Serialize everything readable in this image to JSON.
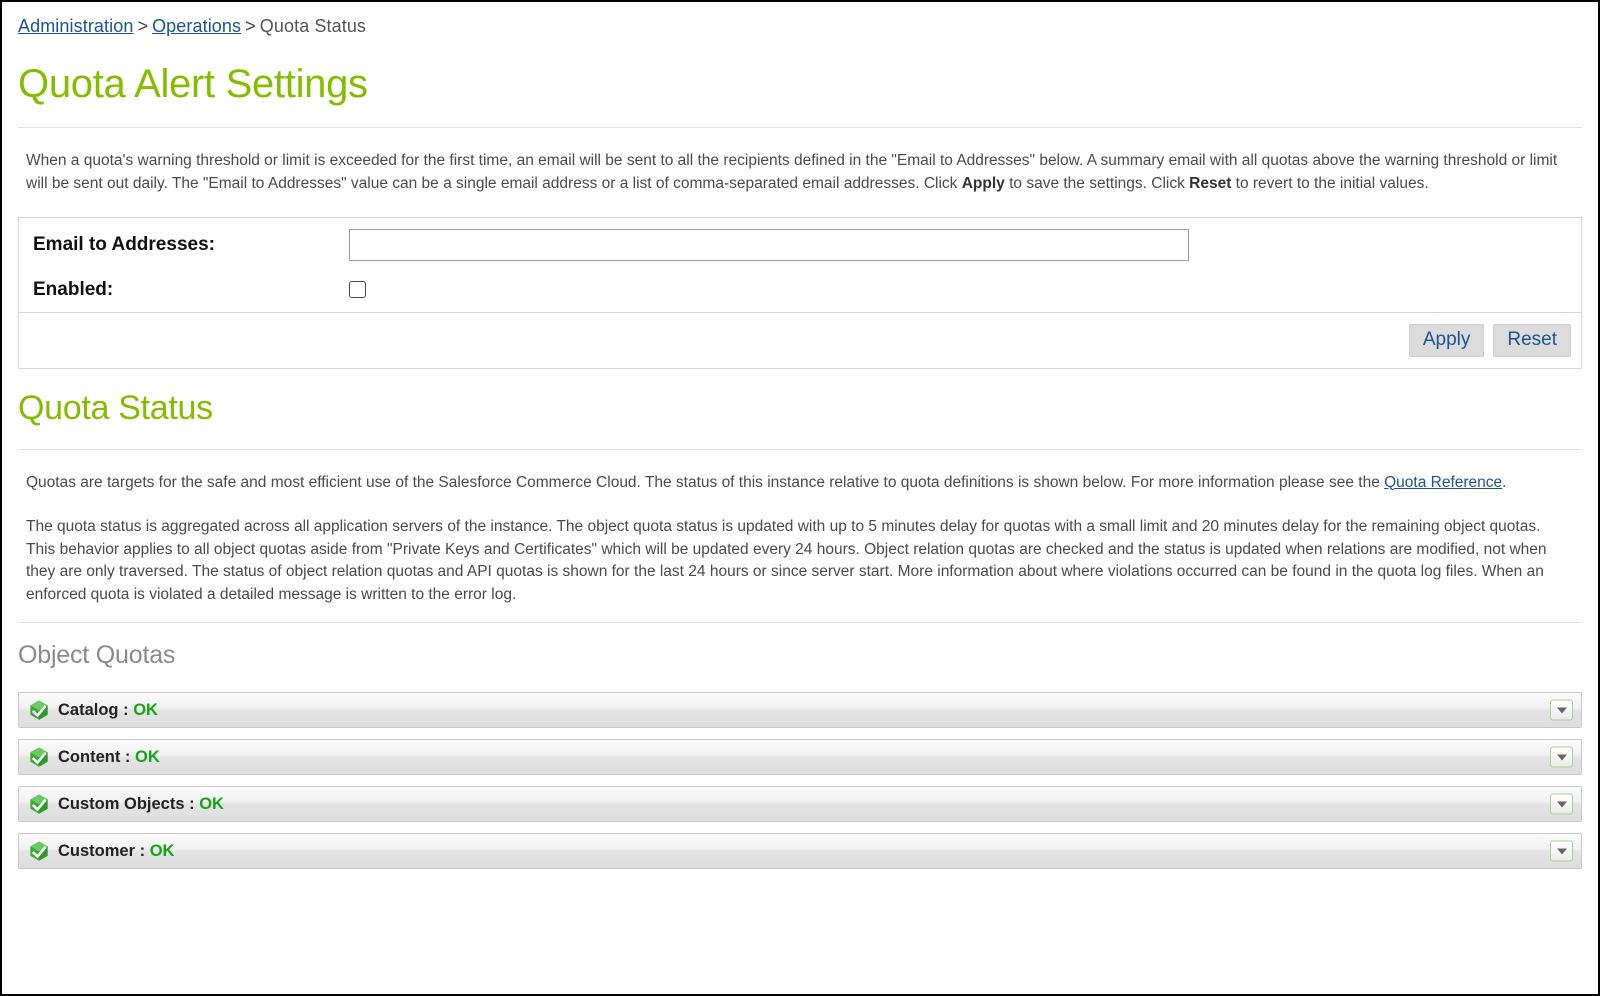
{
  "breadcrumb": {
    "items": [
      {
        "label": "Administration",
        "link": true
      },
      {
        "label": "Operations",
        "link": true
      },
      {
        "label": "Quota Status",
        "link": false
      }
    ],
    "separator": ">"
  },
  "alert_settings": {
    "title": "Quota Alert Settings",
    "description_parts": {
      "p1": "When a quota's warning threshold or limit is exceeded for the first time, an email will be sent to all the recipients defined in the \"Email to Addresses\" below. A summary email with all quotas above the warning threshold or limit will be sent out daily. The \"Email to Addresses\" value can be a single email address or a list of comma-separated email addresses. Click ",
      "apply_bold": "Apply",
      "p2": " to save the settings. Click ",
      "reset_bold": "Reset",
      "p3": " to revert to the initial values."
    },
    "email_label": "Email to Addresses:",
    "email_value": "",
    "email_placeholder": "",
    "enabled_label": "Enabled:",
    "enabled_checked": false,
    "apply_label": "Apply",
    "reset_label": "Reset"
  },
  "quota_status": {
    "title": "Quota Status",
    "intro_part1": "Quotas are targets for the safe and most efficient use of the Salesforce Commerce Cloud. The status of this instance relative to quota definitions is shown below. For more information please see the ",
    "intro_link": "Quota Reference",
    "intro_part2": ".",
    "details": "The quota status is aggregated across all application servers of the instance. The object quota status is updated with up to 5 minutes delay for quotas with a small limit and 20 minutes delay for the remaining object quotas. This behavior applies to all object quotas aside from \"Private Keys and Certificates\" which will be updated every 24 hours. Object relation quotas are checked and the status is updated when relations are modified, not when they are only traversed. The status of object relation quotas and API quotas is shown for the last 24 hours or since server start. More information about where violations occurred can be found in the quota log files. When an enforced quota is violated a detailed message is written to the error log."
  },
  "object_quotas": {
    "section_title": "Object Quotas",
    "separator": " : ",
    "rows": [
      {
        "name": "Catalog",
        "status": "OK",
        "icon": "green-check-badge-icon",
        "expanded": false
      },
      {
        "name": "Content",
        "status": "OK",
        "icon": "green-check-badge-icon",
        "expanded": false
      },
      {
        "name": "Custom Objects",
        "status": "OK",
        "icon": "green-check-badge-icon",
        "expanded": false
      },
      {
        "name": "Customer",
        "status": "OK",
        "icon": "green-check-badge-icon",
        "expanded": false
      }
    ]
  },
  "colors": {
    "heading_green": "#84bd00",
    "status_ok_green": "#19a219",
    "link_blue": "#1a5490",
    "body_text": "#4a4a4a",
    "section_gray": "#8a8a8a"
  }
}
